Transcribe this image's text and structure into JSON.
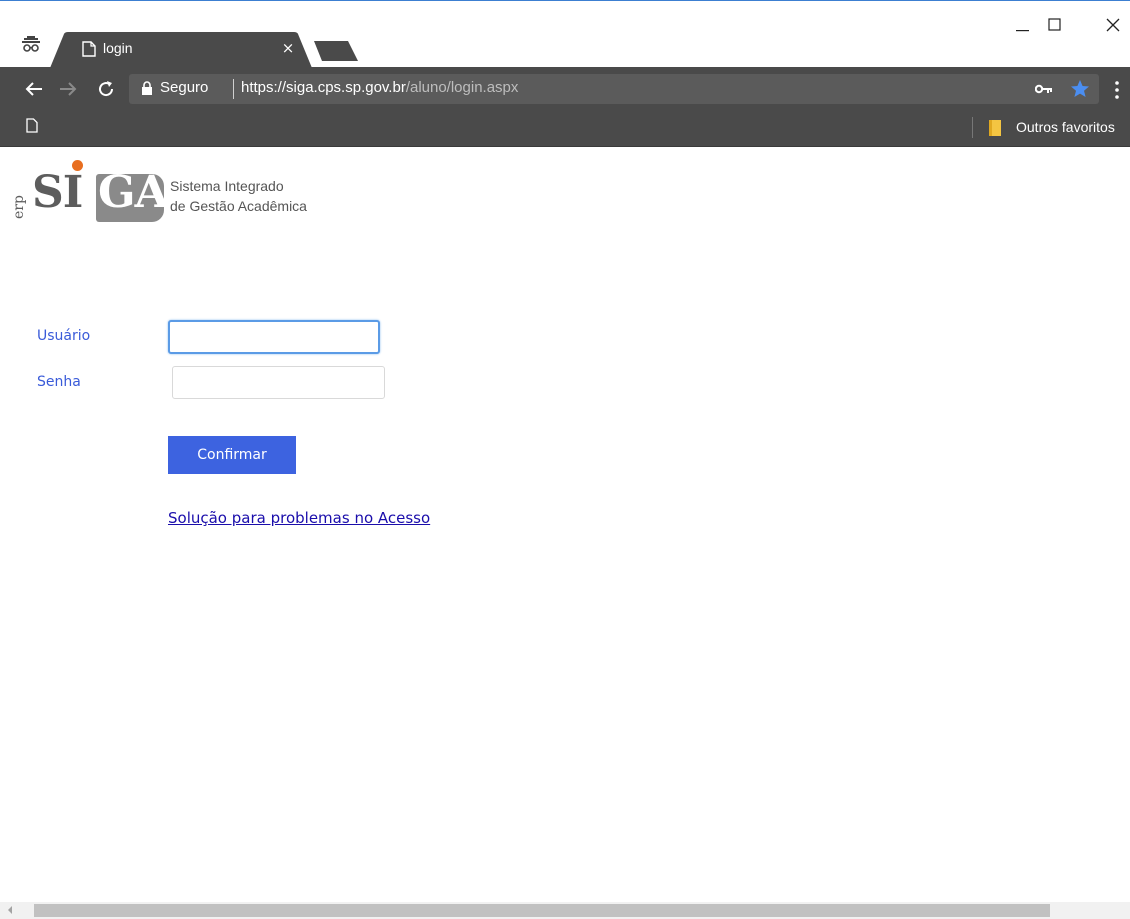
{
  "browser": {
    "tab": {
      "title": "login",
      "close": "×"
    },
    "address_bar": {
      "security_label": "Seguro",
      "url_scheme": "https://",
      "url_host": "siga.cps.sp.gov.br",
      "url_path": "/aluno/login.aspx"
    },
    "bookmarks": {
      "folder_label": "Outros favoritos"
    },
    "icons": [
      "incognito-icon",
      "page-icon",
      "close-icon",
      "back-icon",
      "forward-icon",
      "reload-icon",
      "lock-icon",
      "key-icon",
      "star-icon",
      "menu-icon",
      "folder-icon",
      "minimize-icon",
      "maximize-icon"
    ]
  },
  "logo": {
    "erp": "erp",
    "si": "SI",
    "ga": "GA",
    "line1": "Sistema Integrado",
    "line2": "de Gestão Acadêmica",
    "colors": {
      "dot": "#e86e1f",
      "box": "#8a8a8a",
      "text": "#5d5d5d"
    }
  },
  "login_form": {
    "username_label": "Usuário",
    "username_value": "",
    "password_label": "Senha",
    "password_value": "",
    "confirm_button": "Confirmar",
    "help_link": "Solução para problemas no Acesso"
  },
  "colors": {
    "label": "#3a5bd9",
    "button": "#3d63e0",
    "link": "#1a0dab",
    "toolbar": "#4a4a4a"
  }
}
